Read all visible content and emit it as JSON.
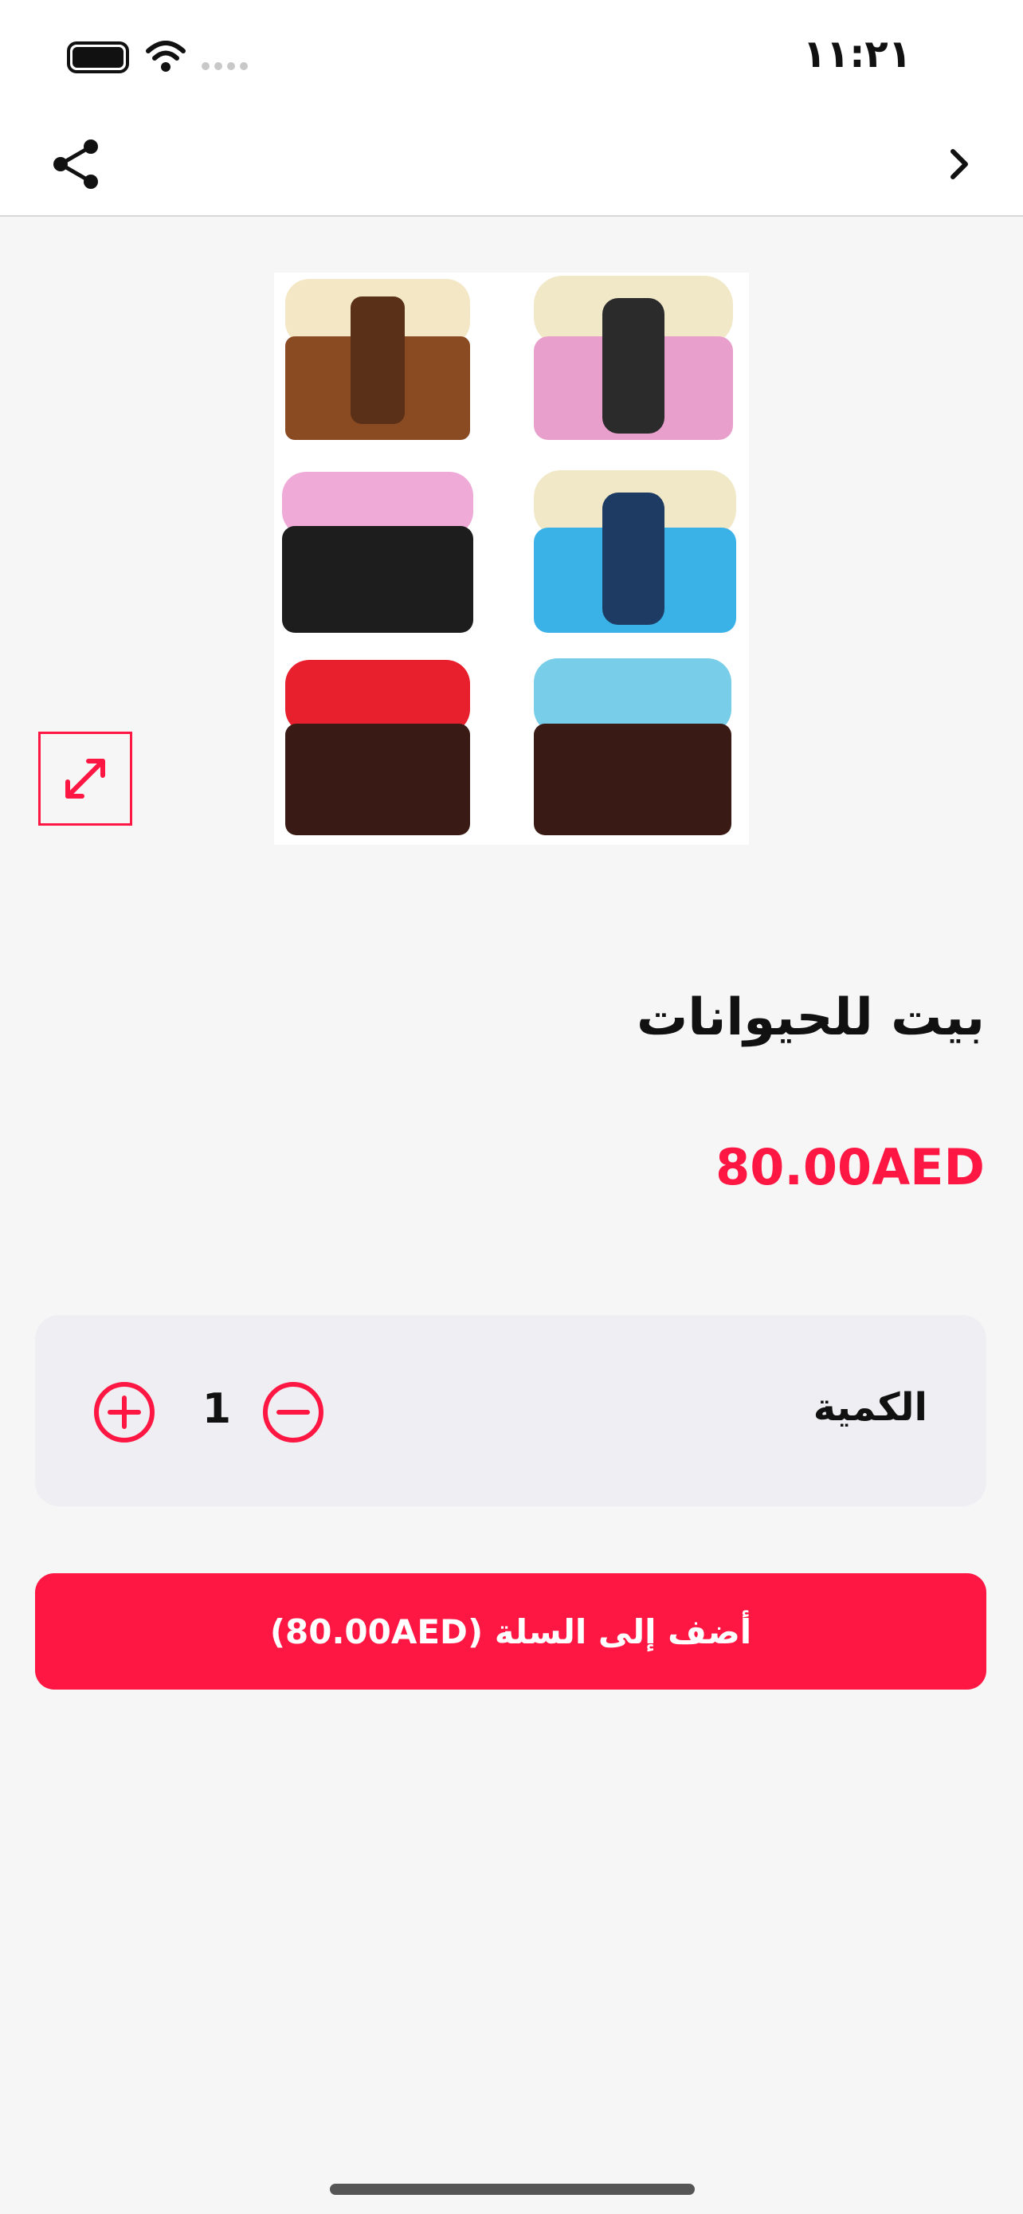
{
  "status_bar": {
    "time": "١١:٢١",
    "icons": [
      "battery-icon",
      "wifi-icon",
      "signal-icon"
    ]
  },
  "nav": {
    "share_icon": "share-icon",
    "back_icon": "chevron-right-icon"
  },
  "product": {
    "image_alt": "pet playpen tents",
    "expand_icon": "expand-icon",
    "title": "بيت للحيوانات",
    "price": "80.00AED"
  },
  "quantity": {
    "label": "الكمية",
    "value": "1",
    "plus_icon": "plus-circle-icon",
    "minus_icon": "minus-circle-icon"
  },
  "add_to_cart": {
    "label": "أضف إلى السلة (80.00AED)"
  },
  "colors": {
    "accent": "#ff1744",
    "background": "#f6f6f6",
    "card": "#efeff3"
  }
}
